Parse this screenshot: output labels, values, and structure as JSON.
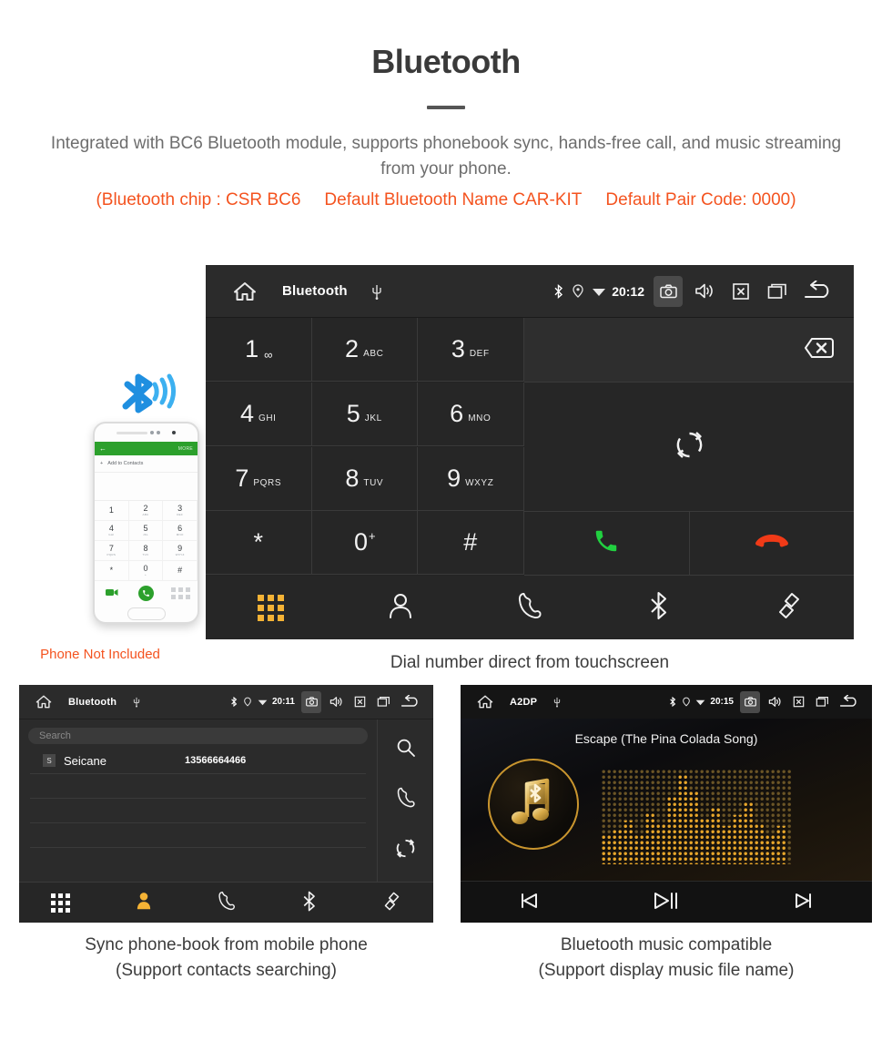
{
  "header": {
    "title": "Bluetooth",
    "intro": "Integrated with BC6 Bluetooth module, supports phonebook sync, hands-free call, and music streaming from your phone.",
    "spec_chip": "(Bluetooth chip : CSR BC6",
    "spec_name": "Default Bluetooth Name CAR-KIT",
    "spec_code": "Default Pair Code: 0000)",
    "accent_color": "#f4531f",
    "text_color": "#6d6d6d"
  },
  "phone_illustration": {
    "note": "Phone Not Included",
    "bluetooth_icon": "bluetooth-icon",
    "screen": {
      "back_label": "←",
      "more_label": "MORE",
      "add_contact_label": "Add to Contacts",
      "keys": [
        {
          "num": "1",
          "sub": ""
        },
        {
          "num": "2",
          "sub": "ABC"
        },
        {
          "num": "3",
          "sub": "DEF"
        },
        {
          "num": "4",
          "sub": "GHI"
        },
        {
          "num": "5",
          "sub": "JKL"
        },
        {
          "num": "6",
          "sub": "MNO"
        },
        {
          "num": "7",
          "sub": "PQRS"
        },
        {
          "num": "8",
          "sub": "TUV"
        },
        {
          "num": "9",
          "sub": "WXYZ"
        },
        {
          "num": "*",
          "sub": ""
        },
        {
          "num": "0",
          "sub": "+"
        },
        {
          "num": "#",
          "sub": ""
        }
      ]
    }
  },
  "dialer": {
    "statusbar": {
      "home_icon": "home-icon",
      "title": "Bluetooth",
      "usb_icon": "usb-icon",
      "bluetooth_icon": "bluetooth-icon",
      "location_icon": "location-icon",
      "wifi_icon": "wifi-icon",
      "time": "20:12",
      "camera_icon": "camera-icon",
      "volume_icon": "volume-icon",
      "close_icon": "close-box-icon",
      "recents_icon": "recents-icon",
      "back_icon": "back-icon"
    },
    "keys": [
      {
        "num": "1",
        "sub": "",
        "voicemail": "∞"
      },
      {
        "num": "2",
        "sub": "ABC"
      },
      {
        "num": "3",
        "sub": "DEF"
      },
      {
        "num": "4",
        "sub": "GHI"
      },
      {
        "num": "5",
        "sub": "JKL"
      },
      {
        "num": "6",
        "sub": "MNO"
      },
      {
        "num": "7",
        "sub": "PQRS"
      },
      {
        "num": "8",
        "sub": "TUV"
      },
      {
        "num": "9",
        "sub": "WXYZ"
      },
      {
        "num": "*",
        "sub": ""
      },
      {
        "num": "0",
        "sub": "+"
      },
      {
        "num": "#",
        "sub": ""
      }
    ],
    "number_input_value": "",
    "backspace_icon": "backspace-icon",
    "sync_icon": "sync-icon",
    "call_icon": "call-icon",
    "hangup_icon": "hangup-icon",
    "tabs": [
      {
        "name": "keypad",
        "icon": "keypad-icon",
        "active": true
      },
      {
        "name": "contacts",
        "icon": "contact-icon",
        "active": false
      },
      {
        "name": "call-history",
        "icon": "phone-icon",
        "active": false
      },
      {
        "name": "bluetooth",
        "icon": "bluetooth-icon",
        "active": false
      },
      {
        "name": "link",
        "icon": "link-icon",
        "active": false
      }
    ],
    "caption": "Dial number direct from touchscreen"
  },
  "phonebook": {
    "statusbar": {
      "title": "Bluetooth",
      "time": "20:11"
    },
    "search_placeholder": "Search",
    "contacts": [
      {
        "initial": "S",
        "name": "Seicane",
        "number": "13566664466"
      }
    ],
    "rail": [
      {
        "name": "search",
        "icon": "search-icon"
      },
      {
        "name": "call",
        "icon": "phone-icon"
      },
      {
        "name": "sync",
        "icon": "sync-icon"
      }
    ],
    "tabs": [
      {
        "name": "keypad",
        "icon": "keypad-icon",
        "active": false
      },
      {
        "name": "contacts",
        "icon": "contact-icon",
        "active": true
      },
      {
        "name": "call-history",
        "icon": "phone-icon",
        "active": false
      },
      {
        "name": "bluetooth",
        "icon": "bluetooth-icon",
        "active": false
      },
      {
        "name": "link",
        "icon": "link-icon",
        "active": false
      }
    ],
    "caption_line1": "Sync phone-book from mobile phone",
    "caption_line2": "(Support contacts searching)"
  },
  "music": {
    "statusbar": {
      "title": "A2DP",
      "time": "20:15"
    },
    "song_title": "Escape (The Pina Colada Song)",
    "logo_icon": "music-bluetooth-icon",
    "controls": [
      {
        "name": "previous",
        "icon": "previous-icon"
      },
      {
        "name": "play-pause",
        "icon": "play-pause-icon"
      },
      {
        "name": "next",
        "icon": "next-icon"
      }
    ],
    "caption_line1": "Bluetooth music compatible",
    "caption_line2": "(Support display music file name)"
  }
}
